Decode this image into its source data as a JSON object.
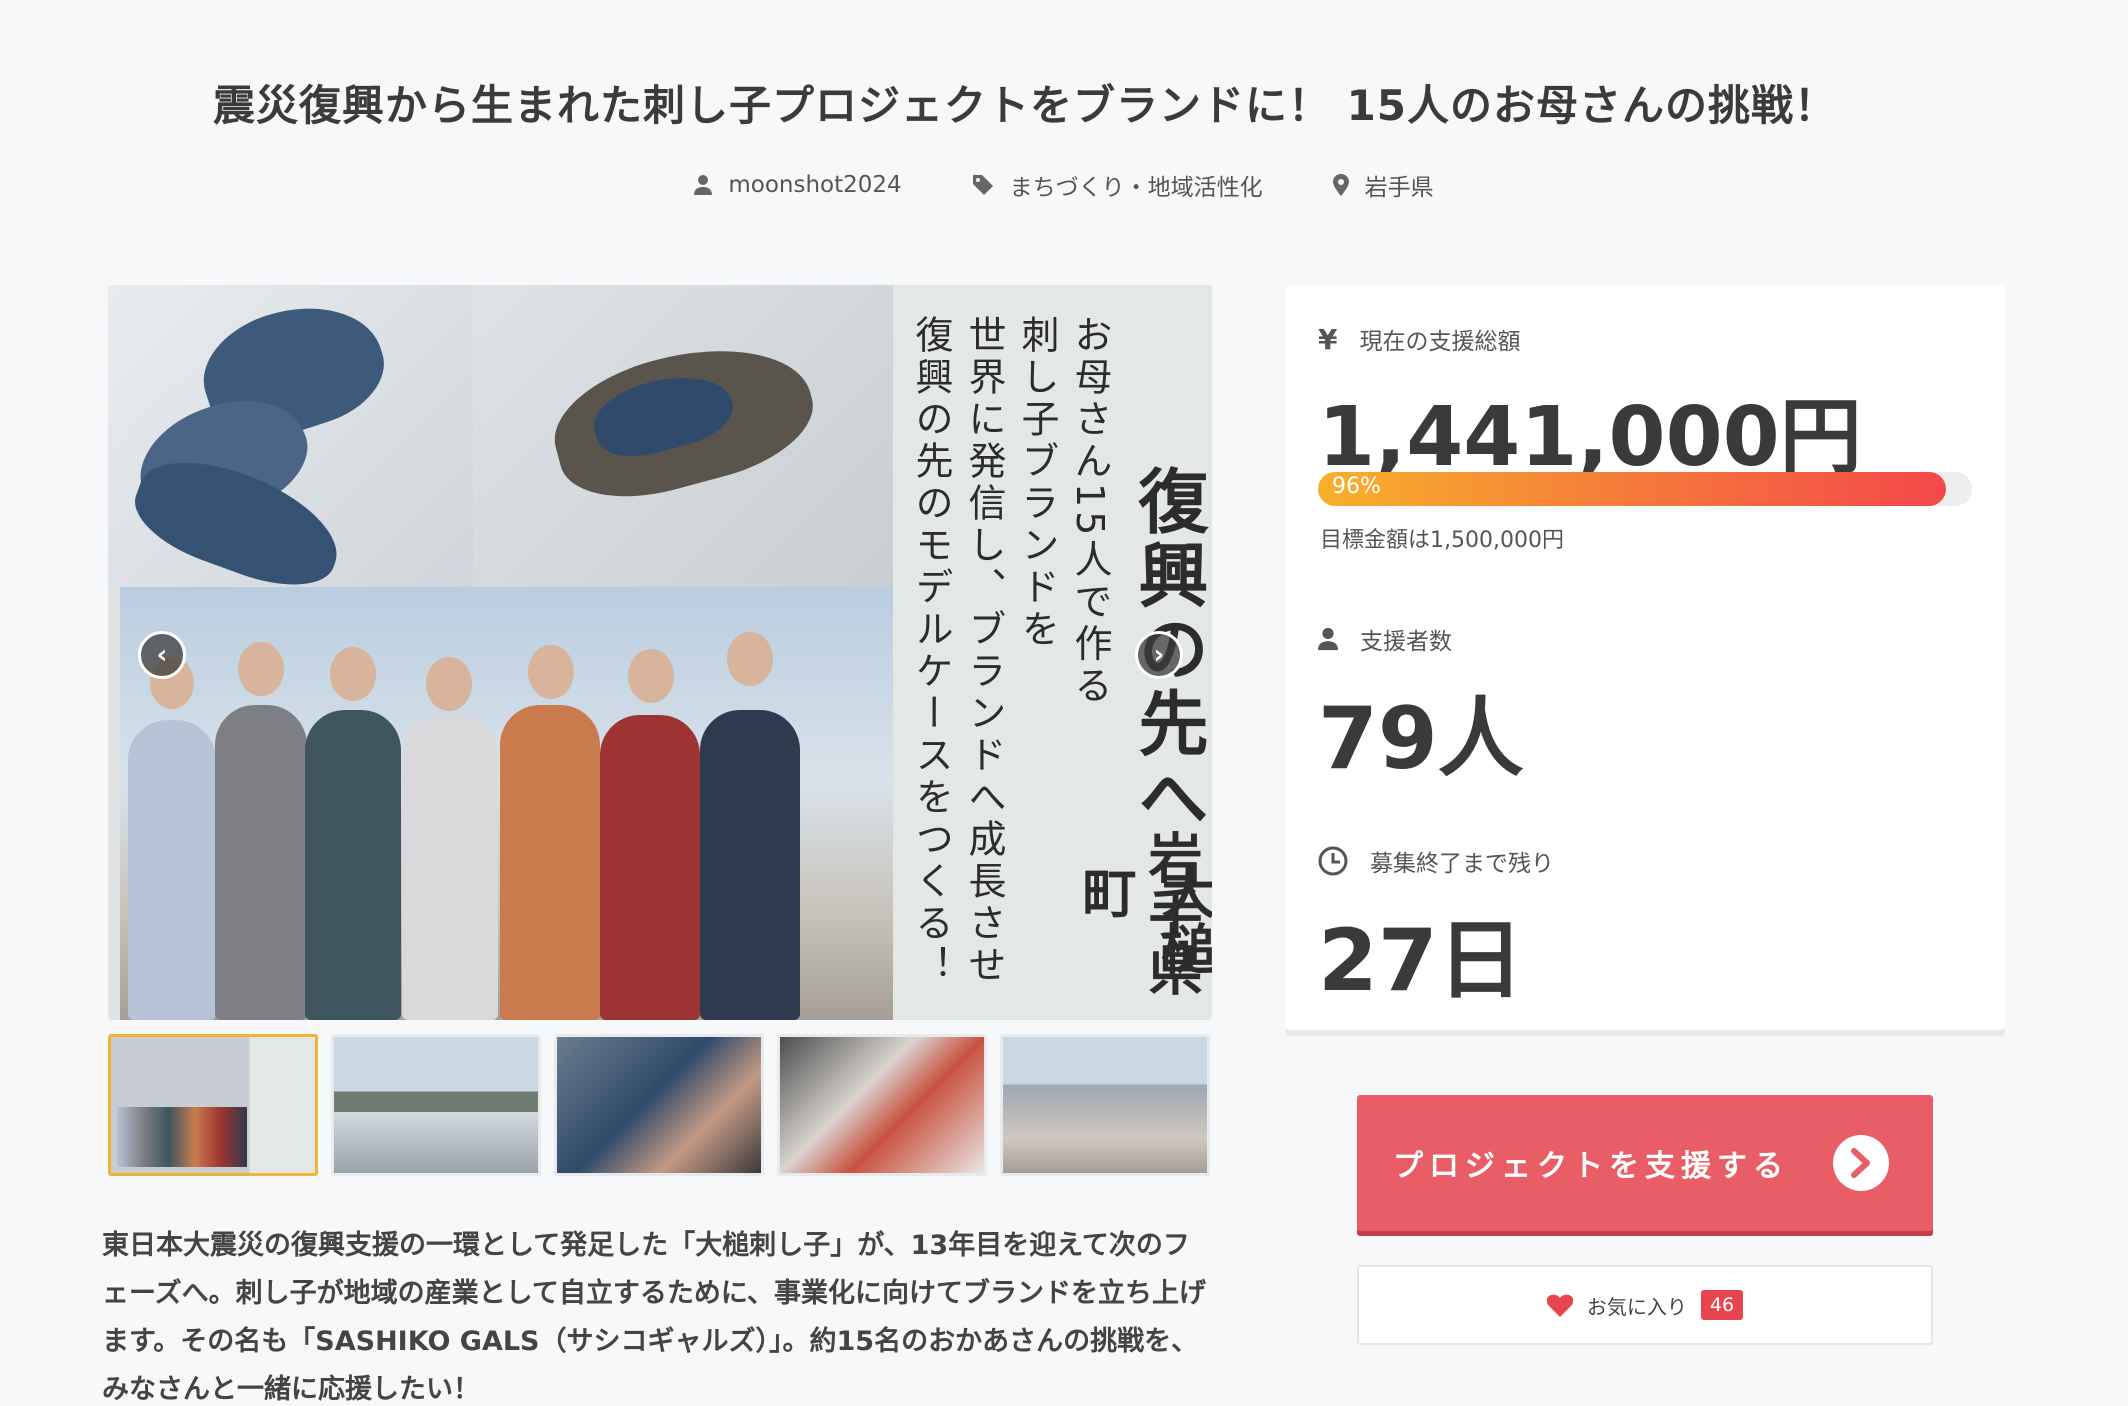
{
  "project": {
    "title": "震災復興から生まれた刺し子プロジェクトをブランドに！ 15人のお母さんの挑戦！",
    "author": "moonshot2024",
    "category": "まちづくり・地域活性化",
    "location": "岩手県"
  },
  "hero": {
    "heading": "復興の先へ",
    "lines": [
      "お母さん15人で作る",
      "刺し子ブランドを",
      "世界に発信し、ブランドへ成長させ",
      "復興の先のモデルケースをつくる！"
    ],
    "place_pref": "岩手県",
    "place_town": "大槌町",
    "prev_icon": "chevron-left-icon",
    "next_icon": "chevron-right-icon"
  },
  "description": "東日本大震災の復興支援の一環として発足した「大槌刺し子」が、13年目を迎えて次のフェーズへ。刺し子が地域の産業として自立するために、事業化に向けてブランドを立ち上げます。その名も「SASHIKO GALS（サシコギャルズ）」。約15名のおかあさんの挑戦を、みなさんと一緒に応援したい！",
  "funding": {
    "total_label": "現在の支援総額",
    "total_value": "1,441,000円",
    "progress_percent": 96,
    "progress_text": "96%",
    "goal_text": "目標金額は1,500,000円",
    "backers_label": "支援者数",
    "backers_value": "79人",
    "remaining_label": "募集終了まで残り",
    "remaining_value": "27日"
  },
  "actions": {
    "support_label": "プロジェクトを支援する",
    "favorite_label": "お気に入り",
    "favorite_count": "46"
  },
  "colors": {
    "accent": "#e95d66",
    "progress_start": "#f7b02b",
    "progress_end": "#f4474a",
    "active_thumb": "#f2b233"
  }
}
